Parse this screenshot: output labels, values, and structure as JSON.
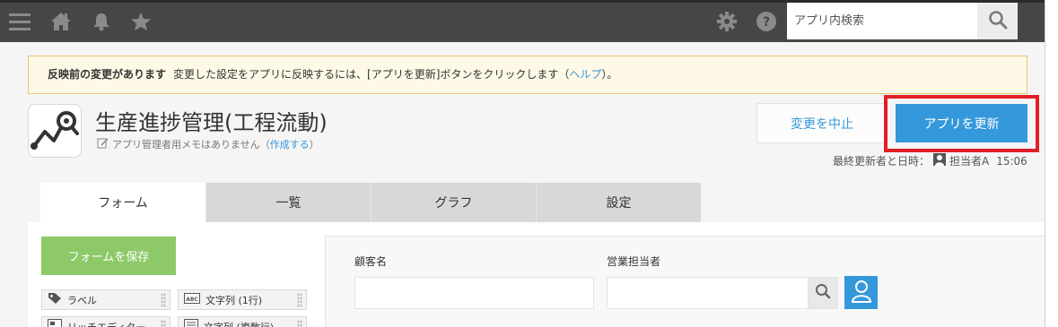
{
  "topbar": {
    "icons": [
      "menu-icon",
      "home-icon",
      "bell-icon",
      "star-icon",
      "gear-icon",
      "help-icon",
      "search-icon"
    ],
    "search_placeholder": "アプリ内検索"
  },
  "notice": {
    "strong": "反映前の変更があります",
    "text_before": "変更した設定をアプリに反映するには、[アプリを更新]ボタンをクリックします（",
    "help_link": "ヘルプ",
    "text_after": "）。"
  },
  "app": {
    "title": "生産進捗管理(工程流動)",
    "memo_text": "アプリ管理者用メモはありません（",
    "memo_link": "作成する",
    "memo_close": "）"
  },
  "actions": {
    "cancel_label": "変更を中止",
    "update_label": "アプリを更新"
  },
  "last_modified": {
    "label": "最終更新者と日時：",
    "user": "担当者A",
    "time": "15:06"
  },
  "tabs": [
    {
      "label": "フォーム",
      "active": true
    },
    {
      "label": "一覧",
      "active": false
    },
    {
      "label": "グラフ",
      "active": false
    },
    {
      "label": "設定",
      "active": false
    }
  ],
  "form_editor": {
    "save_label": "フォームを保存",
    "parts": [
      {
        "label": "ラベル",
        "icon": "label-tag-icon"
      },
      {
        "label": "文字列 (1行)",
        "icon": "text-field-icon"
      },
      {
        "label": "リッチエディター",
        "icon": "rich-editor-icon"
      },
      {
        "label": "文字列 (複数行)",
        "icon": "text-area-icon"
      }
    ],
    "fields": [
      {
        "label": "顧客名"
      },
      {
        "label": "営業担当者"
      }
    ]
  },
  "colors": {
    "topbar": "#464646",
    "accent": "#3498db",
    "save_green": "#8dc968",
    "highlight_red": "#e11f26",
    "notice_bg": "#fdf9e6"
  }
}
